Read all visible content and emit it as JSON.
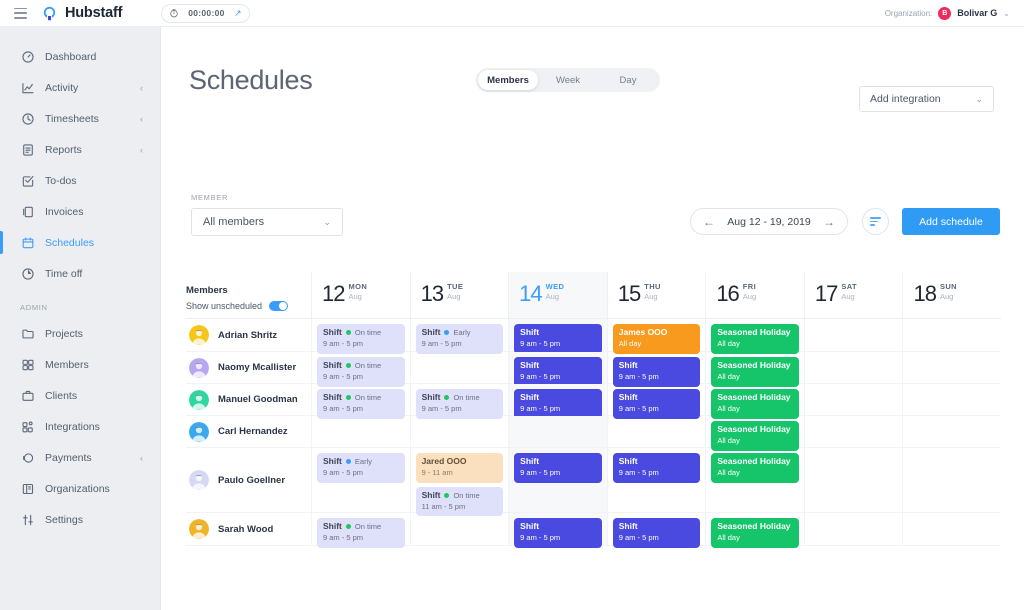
{
  "topbar": {
    "brand": "Hubstaff",
    "timer": "00:00:00",
    "org_label": "Organization:",
    "org_initial": "B",
    "org_name": "Bolivar G"
  },
  "sidebar": {
    "items": [
      {
        "label": "Dashboard",
        "icon": "dashboard-icon",
        "caret": "",
        "active": false
      },
      {
        "label": "Activity",
        "icon": "activity-icon",
        "caret": "‹",
        "active": false
      },
      {
        "label": "Timesheets",
        "icon": "timesheets-icon",
        "caret": "‹",
        "active": false
      },
      {
        "label": "Reports",
        "icon": "reports-icon",
        "caret": "‹",
        "active": false
      },
      {
        "label": "To-dos",
        "icon": "todos-icon",
        "caret": "",
        "active": false
      },
      {
        "label": "Invoices",
        "icon": "invoices-icon",
        "caret": "",
        "active": false
      },
      {
        "label": "Schedules",
        "icon": "schedules-icon",
        "caret": "",
        "active": true
      },
      {
        "label": "Time off",
        "icon": "timeoff-icon",
        "caret": "",
        "active": false
      }
    ],
    "admin_section": "ADMIN",
    "admin_items": [
      {
        "label": "Projects",
        "icon": "folder-icon",
        "caret": ""
      },
      {
        "label": "Members",
        "icon": "members-icon",
        "caret": ""
      },
      {
        "label": "Clients",
        "icon": "briefcase-icon",
        "caret": ""
      },
      {
        "label": "Integrations",
        "icon": "integrations-icon",
        "caret": ""
      },
      {
        "label": "Payments",
        "icon": "payments-icon",
        "caret": "‹"
      },
      {
        "label": "Organizations",
        "icon": "organizations-icon",
        "caret": ""
      },
      {
        "label": "Settings",
        "icon": "settings-icon",
        "caret": ""
      }
    ]
  },
  "page": {
    "title": "Schedules",
    "tabs": [
      {
        "label": "Members",
        "active": true
      },
      {
        "label": "Week",
        "active": false
      },
      {
        "label": "Day",
        "active": false
      }
    ],
    "add_integration": "Add integration",
    "member_filter_label": "MEMBER",
    "member_filter_value": "All members",
    "date_range": "Aug 12 - 19, 2019",
    "prev_arrow": "←",
    "next_arrow": "→",
    "add_schedule": "Add schedule"
  },
  "calendar": {
    "members_header": "Members",
    "show_unscheduled_label": "Show unscheduled",
    "show_unscheduled_on": true,
    "days": [
      {
        "num": "12",
        "dow": "MON",
        "month": "Aug",
        "today": false
      },
      {
        "num": "13",
        "dow": "TUE",
        "month": "Aug",
        "today": false
      },
      {
        "num": "14",
        "dow": "WED",
        "month": "Aug",
        "today": true
      },
      {
        "num": "15",
        "dow": "THU",
        "month": "Aug",
        "today": false
      },
      {
        "num": "16",
        "dow": "FRI",
        "month": "Aug",
        "today": false
      },
      {
        "num": "17",
        "dow": "SAT",
        "month": "Aug",
        "today": false
      },
      {
        "num": "18",
        "dow": "SUN",
        "month": "Aug",
        "today": false
      }
    ],
    "rows": [
      {
        "member": "Adrian Shritz",
        "avatar_bg": "#f5c518",
        "height": 33,
        "cells": [
          [
            {
              "style": "light",
              "title": "Shift",
              "status": "On time",
              "dot": "#22c55e",
              "sub": "9 am - 5 pm"
            }
          ],
          [
            {
              "style": "light",
              "title": "Shift",
              "status": "Early",
              "dot": "#3b9dfb",
              "sub": "9 am - 5 pm"
            }
          ],
          [
            {
              "style": "solid",
              "title": "Shift",
              "status": "",
              "dot": "",
              "sub": "9 am - 5 pm"
            }
          ],
          [
            {
              "style": "orange",
              "title": "James OOO",
              "status": "",
              "dot": "",
              "sub": "All day"
            }
          ],
          [
            {
              "style": "green",
              "title": "Seasoned Holiday",
              "status": "",
              "dot": "",
              "sub": "All day"
            }
          ],
          [],
          []
        ]
      },
      {
        "member": "Naomy Mcallister",
        "avatar_bg": "#b9a6f0",
        "height": 32,
        "cells": [
          [
            {
              "style": "light",
              "title": "Shift",
              "status": "On time",
              "dot": "#22c55e",
              "sub": "9 am - 5 pm"
            }
          ],
          [],
          [
            {
              "style": "solid",
              "title": "Shift",
              "status": "",
              "dot": "",
              "sub": "9 am - 5 pm"
            }
          ],
          [
            {
              "style": "solid",
              "title": "Shift",
              "status": "",
              "dot": "",
              "sub": "9 am - 5 pm"
            }
          ],
          [
            {
              "style": "green",
              "title": "Seasoned Holiday",
              "status": "",
              "dot": "",
              "sub": "All day"
            }
          ],
          [],
          []
        ]
      },
      {
        "member": "Manuel Goodman",
        "avatar_bg": "#2fd6a0",
        "height": 32,
        "cells": [
          [
            {
              "style": "light",
              "title": "Shift",
              "status": "On time",
              "dot": "#22c55e",
              "sub": "9 am - 5 pm"
            }
          ],
          [
            {
              "style": "light",
              "title": "Shift",
              "status": "On time",
              "dot": "#22c55e",
              "sub": "9 am - 5 pm"
            }
          ],
          [
            {
              "style": "solid",
              "title": "Shift",
              "status": "",
              "dot": "",
              "sub": "9 am - 5 pm"
            }
          ],
          [
            {
              "style": "solid",
              "title": "Shift",
              "status": "",
              "dot": "",
              "sub": "9 am - 5 pm"
            }
          ],
          [
            {
              "style": "green",
              "title": "Seasoned Holiday",
              "status": "",
              "dot": "",
              "sub": "All day"
            }
          ],
          [],
          []
        ]
      },
      {
        "member": "Carl Hernandez",
        "avatar_bg": "#3ba7ef",
        "height": 32,
        "cells": [
          [],
          [],
          [],
          [],
          [
            {
              "style": "green",
              "title": "Seasoned Holiday",
              "status": "",
              "dot": "",
              "sub": "All day"
            }
          ],
          [],
          []
        ]
      },
      {
        "member": "Paulo Goellner",
        "avatar_bg": "#d6d9f5",
        "height": 65,
        "cells": [
          [
            {
              "style": "light",
              "title": "Shift",
              "status": "Early",
              "dot": "#3b9dfb",
              "sub": "9 am - 5 pm"
            }
          ],
          [
            {
              "style": "peach",
              "title": "Jared OOO",
              "status": "",
              "dot": "",
              "sub": "9 - 11 am"
            },
            {
              "style": "light",
              "title": "Shift",
              "status": "On time",
              "dot": "#22c55e",
              "sub": "11 am - 5 pm"
            }
          ],
          [
            {
              "style": "solid",
              "title": "Shift",
              "status": "",
              "dot": "",
              "sub": "9 am - 5 pm"
            }
          ],
          [
            {
              "style": "solid",
              "title": "Shift",
              "status": "",
              "dot": "",
              "sub": "9 am - 5 pm"
            }
          ],
          [
            {
              "style": "green",
              "title": "Seasoned Holiday",
              "status": "",
              "dot": "",
              "sub": "All day"
            }
          ],
          [],
          []
        ]
      },
      {
        "member": "Sarah Wood",
        "avatar_bg": "#f0b429",
        "height": 33,
        "cells": [
          [
            {
              "style": "light",
              "title": "Shift",
              "status": "On time",
              "dot": "#22c55e",
              "sub": "9 am - 5 pm"
            }
          ],
          [],
          [
            {
              "style": "solid",
              "title": "Shift",
              "status": "",
              "dot": "",
              "sub": "9 am - 5 pm"
            }
          ],
          [
            {
              "style": "solid",
              "title": "Shift",
              "status": "",
              "dot": "",
              "sub": "9 am - 5 pm"
            }
          ],
          [
            {
              "style": "green",
              "title": "Seasoned Holiday",
              "status": "",
              "dot": "",
              "sub": "All day"
            }
          ],
          [],
          []
        ]
      }
    ]
  },
  "colors": {
    "accent": "#3b9dfb",
    "shift_solid": "#4a4ae0",
    "shift_light": "#dfe0fa",
    "holiday": "#16c46a",
    "ooo_orange": "#f79a1e",
    "ooo_peach": "#fbe0c0"
  }
}
